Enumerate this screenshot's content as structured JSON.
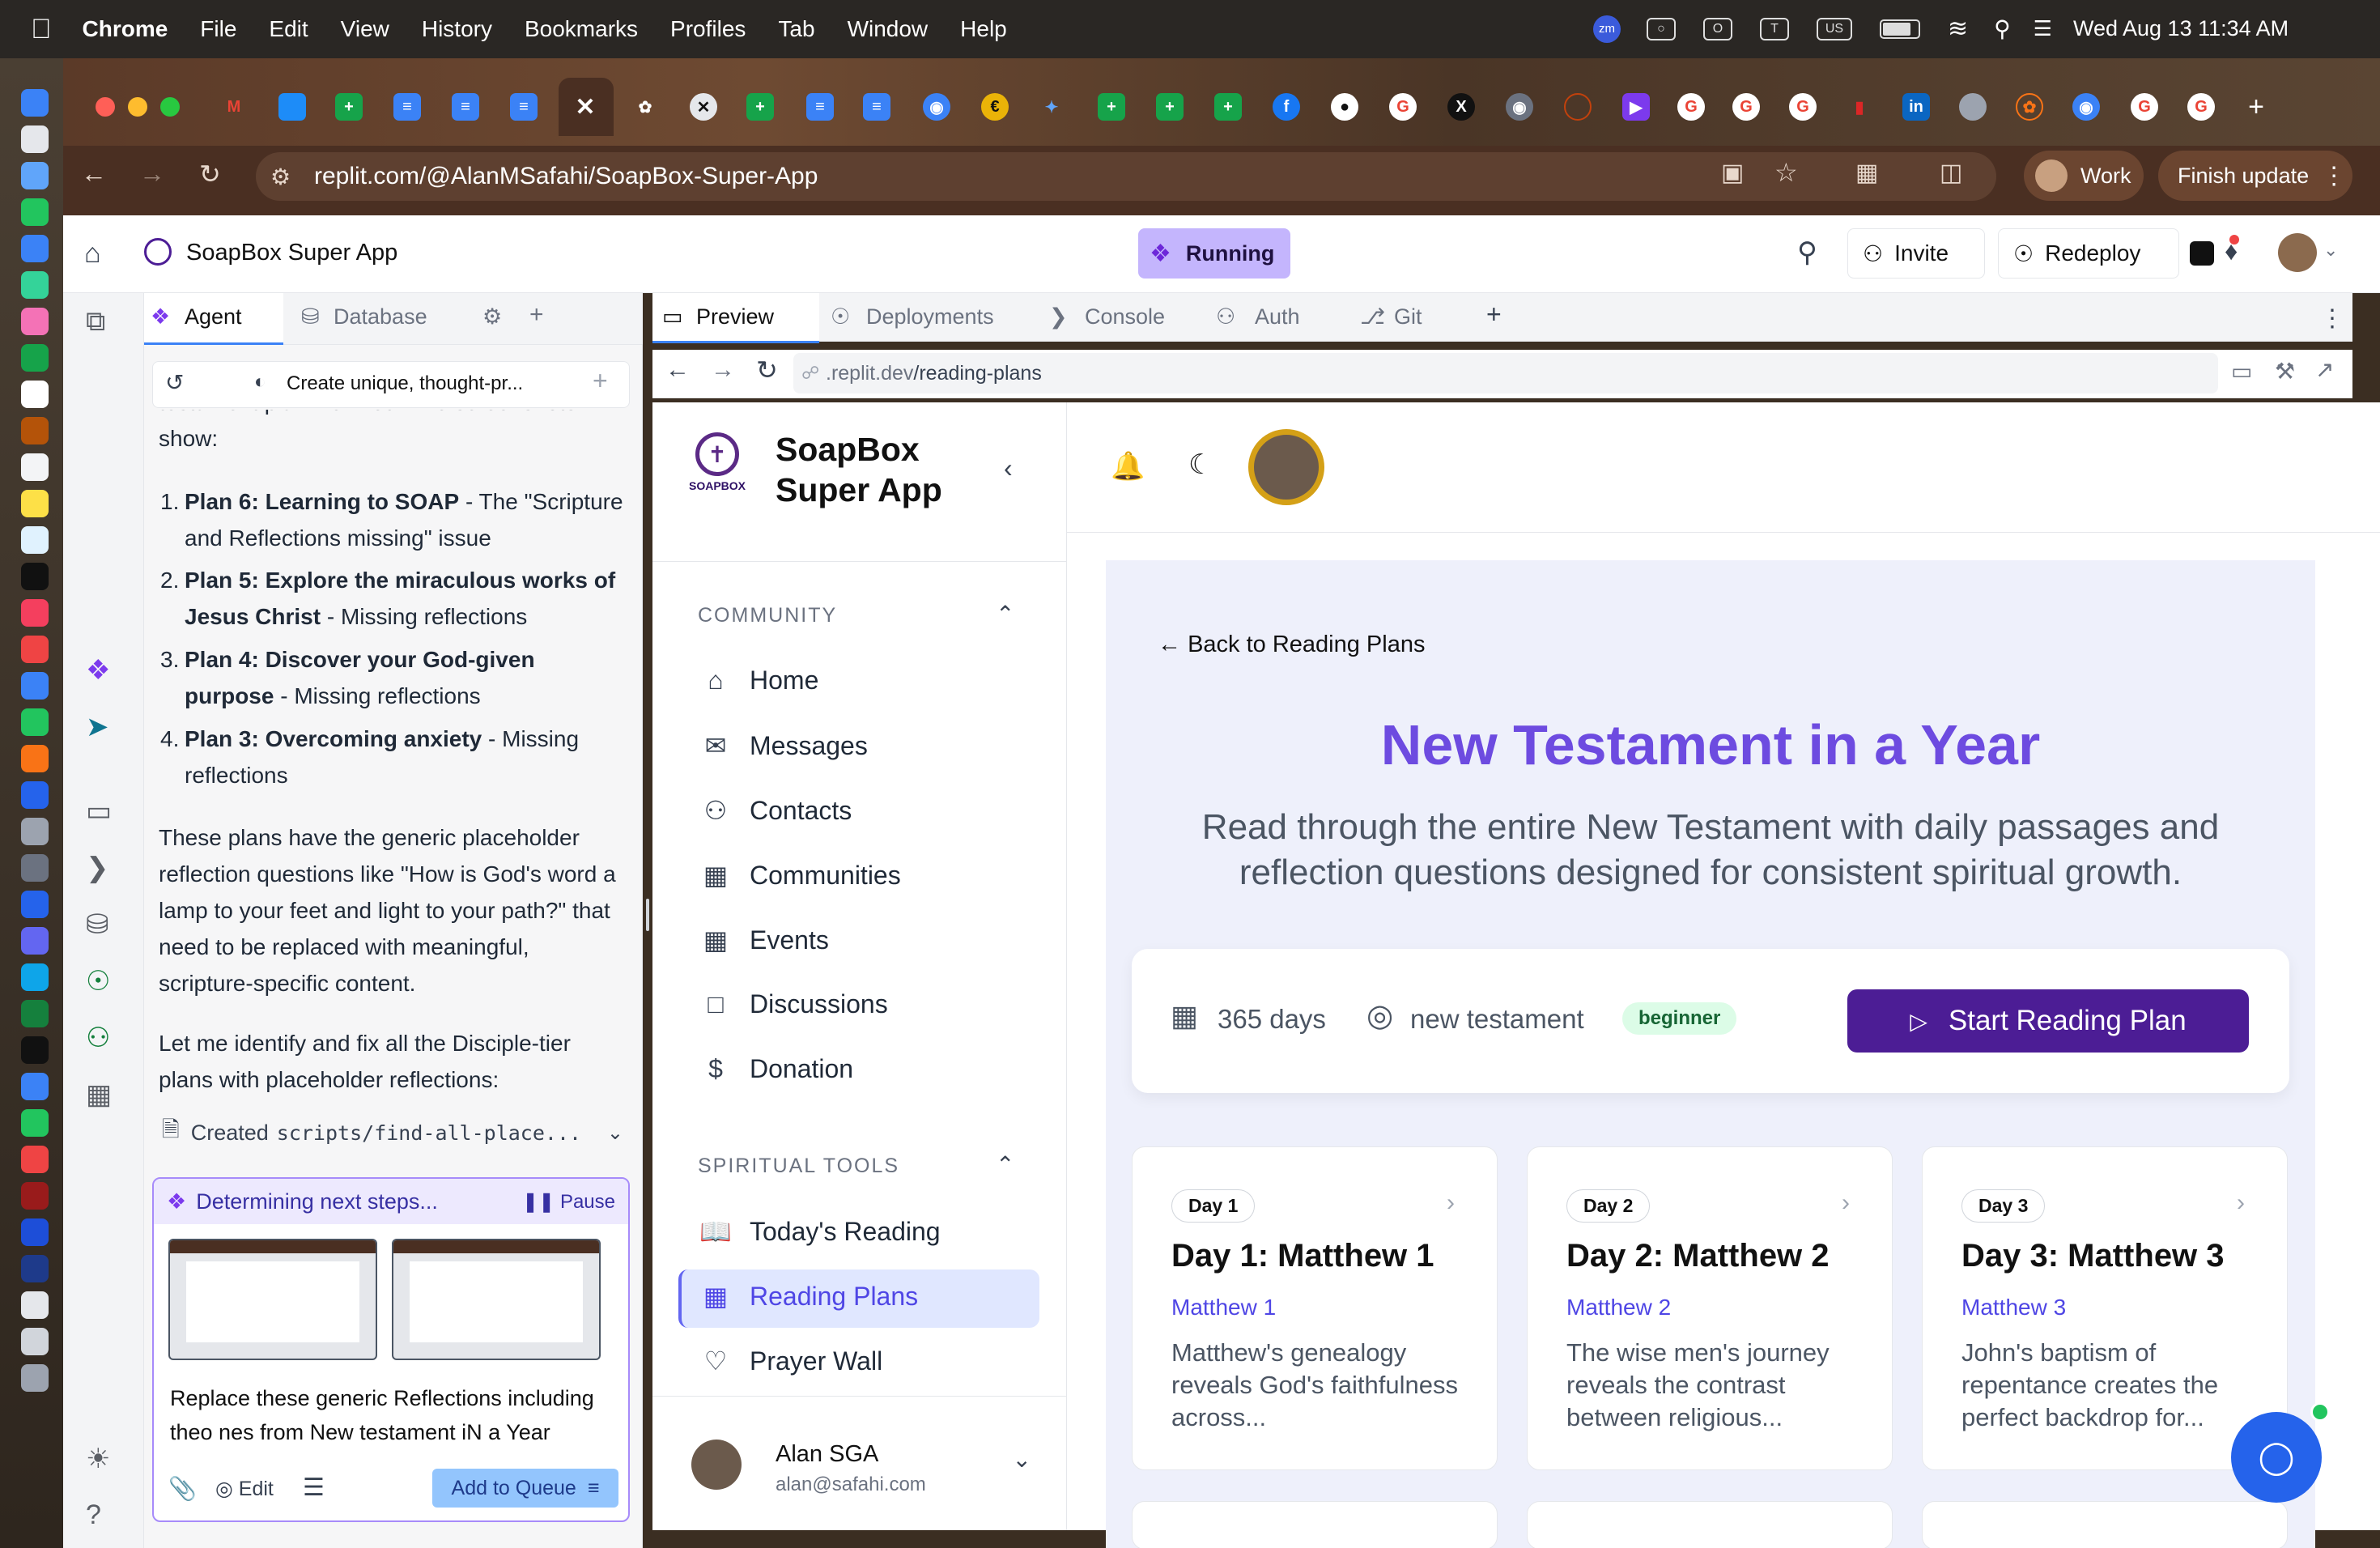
{
  "menubar": {
    "app": "Chrome",
    "items": [
      "File",
      "Edit",
      "View",
      "History",
      "Bookmarks",
      "Profiles",
      "Tab",
      "Window",
      "Help"
    ],
    "input_source": "US",
    "datetime": "Wed Aug 13  11:34 AM",
    "zm": "zm"
  },
  "browser": {
    "url": "replit.com/@AlanMSafahi/SoapBox-Super-App",
    "profile": "Work",
    "finish_update": "Finish update"
  },
  "replit": {
    "project": "SoapBox Super App",
    "status": "Running",
    "invite": "Invite",
    "redeploy": "Redeploy"
  },
  "agent": {
    "tabs": [
      "Agent",
      "Database"
    ],
    "thread_title": "Create unique, thought-pr...",
    "intro": "testament plan we fixed. The screenshots show:",
    "plans": [
      {
        "num": "1.",
        "bold": "Plan 6: Learning to SOAP",
        "rest": " - The \"Scripture and Reflections missing\" issue"
      },
      {
        "num": "2.",
        "bold": "Plan 5: Explore the miraculous works of Jesus Christ",
        "rest": " - Missing reflections"
      },
      {
        "num": "3.",
        "bold": "Plan 4: Discover your God-given purpose",
        "rest": " - Missing reflections"
      },
      {
        "num": "4.",
        "bold": "Plan 3: Overcoming anxiety",
        "rest": " - Missing reflections"
      }
    ],
    "para1": "These plans have the generic placeholder reflection questions like \"How is God's word a lamp to your feet and light to your path?\" that need to be replaced with meaningful, scripture-specific content.",
    "para2": "Let me identify and fix all the Disciple-tier plans with placeholder reflections:",
    "created_label": "Created",
    "created_file": "scripts/find-all-place...",
    "status": "Determining next steps...",
    "pause": "Pause",
    "input_text": "Replace these generic Reflections including theo nes from New testament iN a Year",
    "edit": "Edit",
    "add_queue": "Add to Queue"
  },
  "preview": {
    "tabs": [
      "Preview",
      "Deployments",
      "Console",
      "Auth",
      "Git"
    ],
    "url_host": ".replit.dev",
    "url_path": "/reading-plans"
  },
  "app": {
    "brand_line1": "SoapBox",
    "brand_line2": "Super App",
    "logo_text": "SOAPBOX",
    "community_label": "COMMUNITY",
    "community": [
      "Home",
      "Messages",
      "Contacts",
      "Communities",
      "Events",
      "Discussions",
      "Donation"
    ],
    "spiritual_label": "SPIRITUAL TOOLS",
    "spiritual": [
      "Today's Reading",
      "Reading Plans",
      "Prayer Wall"
    ],
    "user_name": "Alan SGA",
    "user_email": "alan@safahi.com"
  },
  "plan": {
    "back": "Back to Reading Plans",
    "title": "New Testament in a Year",
    "desc": "Read through the entire New Testament with daily passages and reflection questions designed for consistent spiritual growth.",
    "days": "365 days",
    "category": "new testament",
    "level": "beginner",
    "start": "Start Reading Plan",
    "accent": "#6d4be0",
    "button_color": "#4c1d95",
    "cards": [
      {
        "day": "Day 1",
        "title": "Day 1: Matthew 1",
        "ref": "Matthew 1",
        "desc": "Matthew's genealogy reveals God's faithfulness across..."
      },
      {
        "day": "Day 2",
        "title": "Day 2: Matthew 2",
        "ref": "Matthew 2",
        "desc": "The wise men's journey reveals the contrast between religious..."
      },
      {
        "day": "Day 3",
        "title": "Day 3: Matthew 3",
        "ref": "Matthew 3",
        "desc": "John's baptism of repentance creates the perfect backdrop for..."
      }
    ]
  }
}
